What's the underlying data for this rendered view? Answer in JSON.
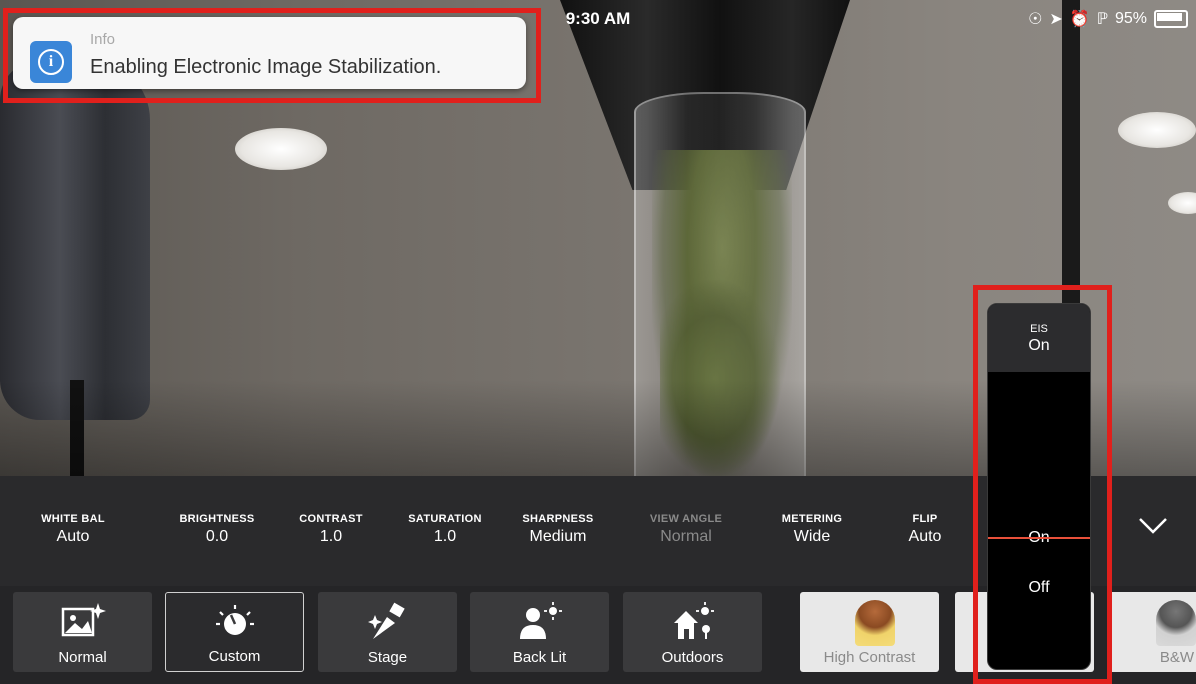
{
  "status_bar": {
    "time": "9:30 AM",
    "battery": "95%"
  },
  "toast": {
    "title": "Info",
    "message": "Enabling Electronic Image Stabilization."
  },
  "settings": [
    {
      "label": "WHITE BAL",
      "value": "Auto",
      "enabled": true
    },
    {
      "label": "BRIGHTNESS",
      "value": "0.0",
      "enabled": true
    },
    {
      "label": "CONTRAST",
      "value": "1.0",
      "enabled": true
    },
    {
      "label": "SATURATION",
      "value": "1.0",
      "enabled": true
    },
    {
      "label": "SHARPNESS",
      "value": "Medium",
      "enabled": true
    },
    {
      "label": "VIEW ANGLE",
      "value": "Normal",
      "enabled": false
    },
    {
      "label": "METERING",
      "value": "Wide",
      "enabled": true
    },
    {
      "label": "FLIP",
      "value": "Auto",
      "enabled": true
    }
  ],
  "presets": [
    {
      "name": "Normal",
      "icon": "landscape-sparkle-icon"
    },
    {
      "name": "Custom",
      "icon": "dial-icon",
      "selected": true
    },
    {
      "name": "Stage",
      "icon": "spotlight-icon"
    },
    {
      "name": "Back Lit",
      "icon": "person-sun-icon"
    },
    {
      "name": "Outdoors",
      "icon": "house-sun-icon"
    },
    {
      "name": "High Contrast",
      "icon": "photo-thumbnail"
    },
    {
      "name": "B&W",
      "icon": "photo-thumbnail"
    }
  ],
  "eis_picker": {
    "label": "EIS",
    "current": "On",
    "options": [
      "On",
      "Off"
    ]
  },
  "colors": {
    "highlight": "#e0201c",
    "picker_line": "#e8503a",
    "info_blue": "#3a86d8"
  }
}
